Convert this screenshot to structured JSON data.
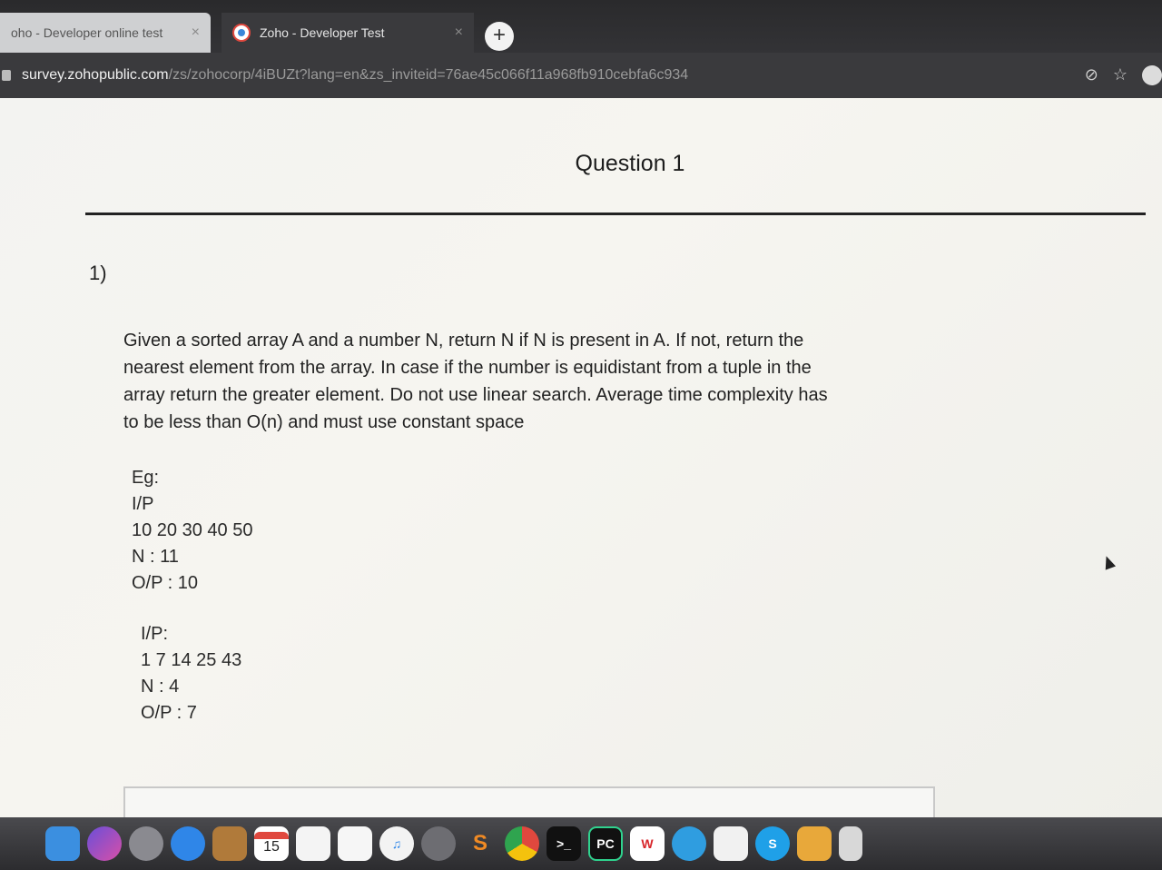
{
  "browser": {
    "tabs": [
      {
        "title": "oho - Developer online test",
        "close": "×"
      },
      {
        "title": "Zoho - Developer Test",
        "close": "×"
      }
    ],
    "new_tab": "+",
    "url_host": "survey.zohopublic.com",
    "url_path": "/zs/zohocorp/4iBUZt?lang=en&zs_inviteid=76ae45c066f11a968fb910cebfa6c934",
    "star": "☆",
    "icons": [
      "eye-off-icon",
      "star-icon",
      "profile-icon"
    ]
  },
  "question": {
    "title": "Question 1",
    "number": "1)",
    "text": [
      "Given a sorted array A and a number N, return N if N is present in A. If not, return the",
      "nearest element from the array. In case if the number is equidistant from a tuple in the",
      "array return the greater element. Do not use linear search. Average time complexity has",
      "to be less than O(n) and must use constant space"
    ],
    "example1": [
      "Eg:",
      "I/P",
      "10 20 30 40 50",
      "N : 11",
      "O/P : 10"
    ],
    "example2": [
      "I/P:",
      "1 7 14 25 43",
      "N : 4",
      "O/P : 7"
    ]
  },
  "dock": {
    "calendar_day": "15",
    "pycharm_label": "PC",
    "wps_label": "W",
    "skype_label": "S",
    "items": [
      "finder-icon",
      "siri-icon",
      "launchpad-icon",
      "safari-icon",
      "notes-icon",
      "calendar-icon",
      "stickies-icon",
      "reminders-icon",
      "itunes-icon",
      "system-preferences-icon",
      "sublime-icon",
      "chrome-icon",
      "terminal-icon",
      "pycharm-icon",
      "wps-icon",
      "skype-for-business-icon",
      "pages-icon",
      "skype-icon",
      "folder-icon",
      "trash-icon"
    ],
    "colors": {
      "finder": "#3b8fe0",
      "chrome": "#e0483e",
      "trash": "#d8d8d8"
    }
  }
}
